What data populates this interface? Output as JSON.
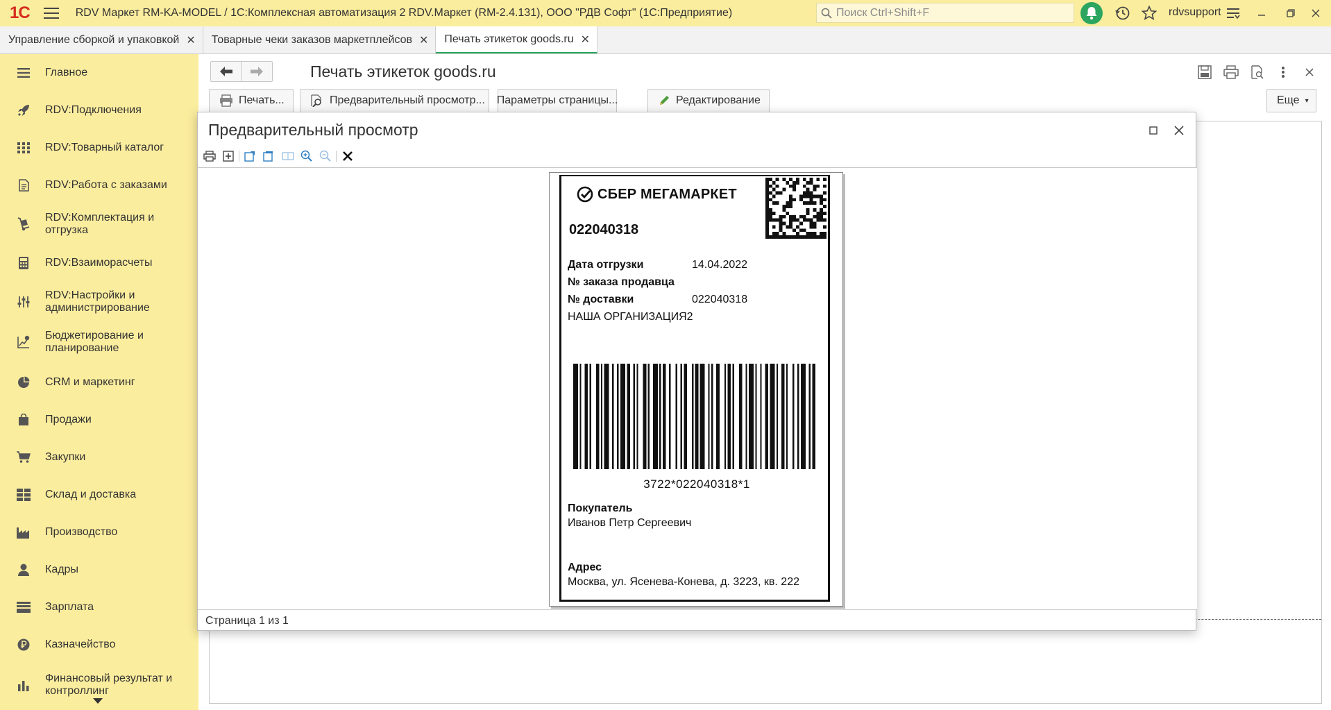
{
  "window": {
    "logo": "1С",
    "title": "RDV Маркет RM-KA-MODEL / 1С:Комплексная автоматизация 2 RDV.Маркет (RM-2.4.131), ООО \"РДВ Софт\"  (1С:Предприятие)",
    "search_placeholder": "Поиск Ctrl+Shift+F",
    "user": "rdvsupport"
  },
  "tabs": [
    {
      "label": "Управление сборкой и упаковкой"
    },
    {
      "label": "Товарные чеки заказов маркетплейсов"
    },
    {
      "label": "Печать этикеток goods.ru"
    }
  ],
  "sidebar": {
    "items": [
      {
        "label": "Главное",
        "icon": "menu-lines-icon"
      },
      {
        "label": "RDV:Подключения",
        "icon": "rocket-icon"
      },
      {
        "label": "RDV:Товарный каталог",
        "icon": "grid-icon"
      },
      {
        "label": "RDV:Работа с заказами",
        "icon": "document-icon"
      },
      {
        "label": "RDV:Комплектация и отгрузка",
        "icon": "hand-truck-icon"
      },
      {
        "label": "RDV:Взаиморасчеты",
        "icon": "calculator-icon"
      },
      {
        "label": "RDV:Настройки и администрирование",
        "icon": "sliders-icon"
      },
      {
        "label": "Бюджетирование и планирование",
        "icon": "budget-chart-icon"
      },
      {
        "label": "CRM и маркетинг",
        "icon": "pie-chart-icon"
      },
      {
        "label": "Продажи",
        "icon": "shopping-bag-icon"
      },
      {
        "label": "Закупки",
        "icon": "cart-icon"
      },
      {
        "label": "Склад и доставка",
        "icon": "warehouse-icon"
      },
      {
        "label": "Производство",
        "icon": "factory-icon"
      },
      {
        "label": "Кадры",
        "icon": "person-icon"
      },
      {
        "label": "Зарплата",
        "icon": "money-icon"
      },
      {
        "label": "Казначейство",
        "icon": "coin-icon"
      },
      {
        "label": "Финансовый результат и контроллинг",
        "icon": "bar-chart-icon"
      }
    ]
  },
  "form": {
    "title": "Печать этикеток goods.ru",
    "buttons": {
      "print": "Печать...",
      "preview": "Предварительный просмотр...",
      "page_params": "Параметры страницы...",
      "edit": "Редактирование",
      "more": "Еще"
    }
  },
  "preview": {
    "title": "Предварительный просмотр",
    "status": "Страница 1 из 1"
  },
  "label": {
    "brand": "СБЕР МЕГАМАРКЕТ",
    "order_number": "022040318",
    "ship_date_label": "Дата отгрузки",
    "ship_date": "14.04.2022",
    "seller_order_label": "№ заказа продавца",
    "delivery_label": "№ доставки",
    "delivery_number": "022040318",
    "organization": "НАША ОРГАНИЗАЦИЯ2",
    "barcode_text": "3722*022040318*1",
    "buyer_label": "Покупатель",
    "buyer": "Иванов Петр Сергеевич",
    "address_label": "Адрес",
    "address": "Москва, ул. Ясенева-Конева, д. 3223, кв. 222"
  },
  "colors": {
    "panel_yellow": "#fbed9e",
    "accent_green": "#2ba55f",
    "logo_red": "#d62c1e"
  }
}
